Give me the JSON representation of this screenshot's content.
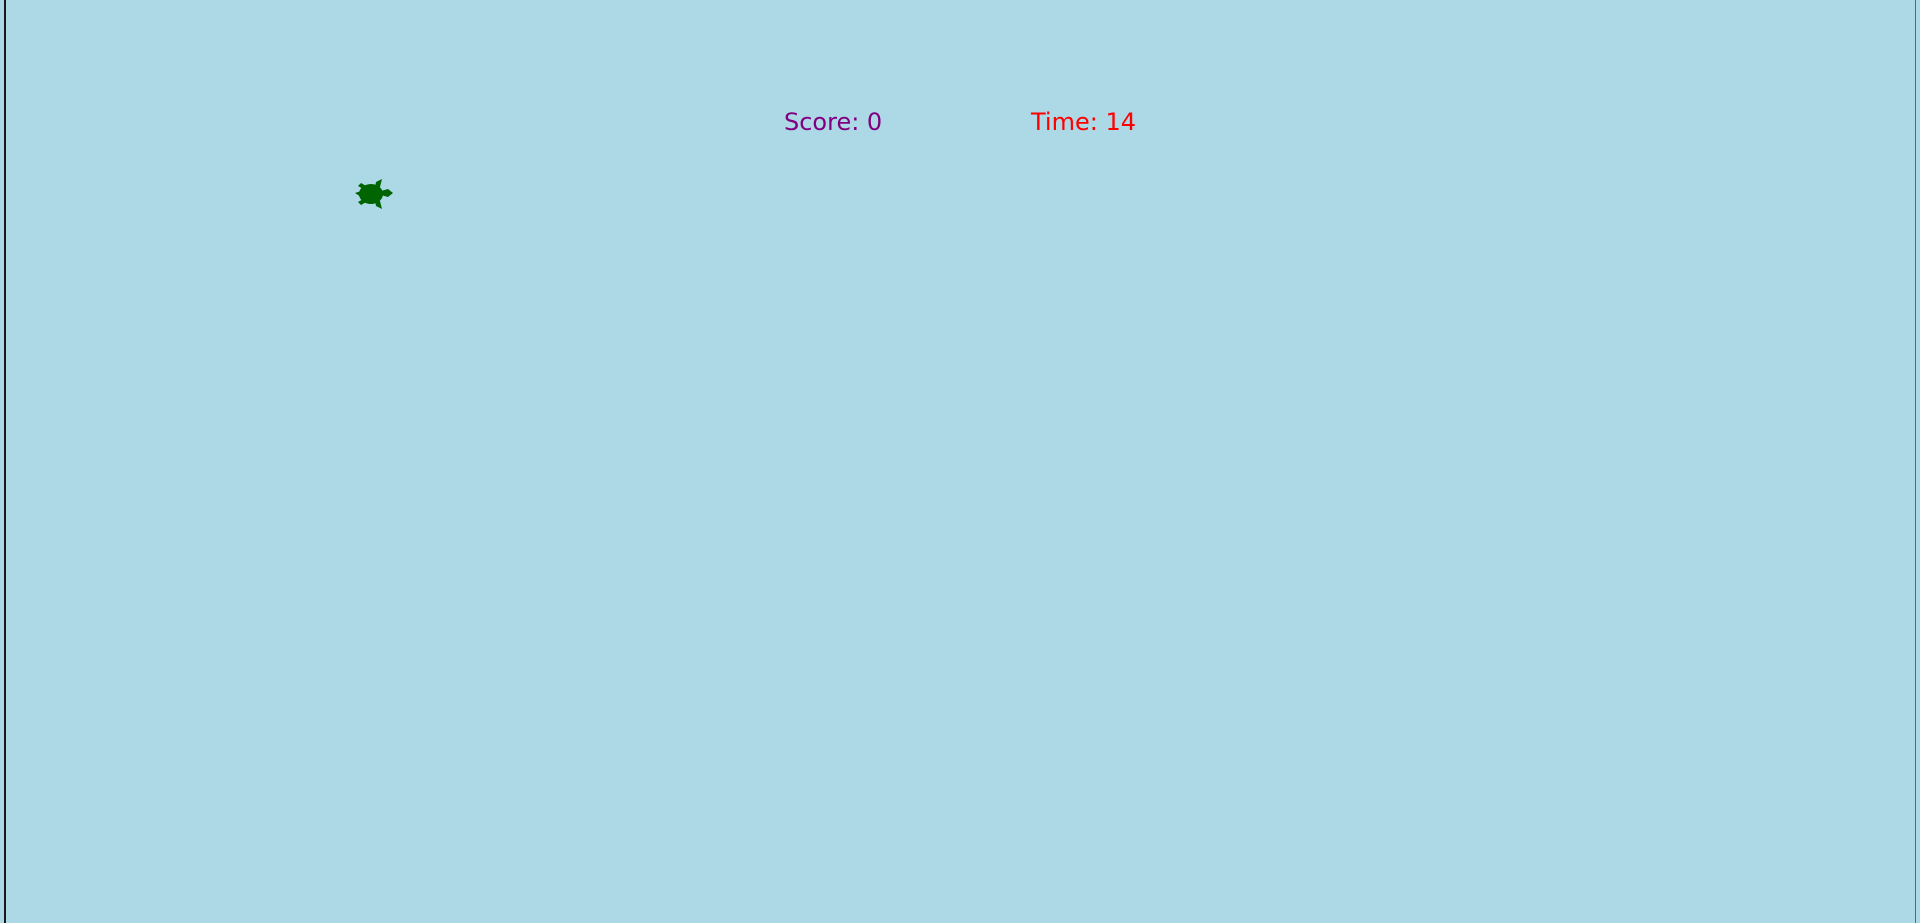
{
  "game": {
    "score_label": "Score: 0",
    "time_label": "Time: 14"
  },
  "colors": {
    "background": "#add8e6",
    "score_text": "#800080",
    "time_text": "#ff0000",
    "turtle": "#006400"
  },
  "icons": {
    "player": "turtle-icon"
  }
}
